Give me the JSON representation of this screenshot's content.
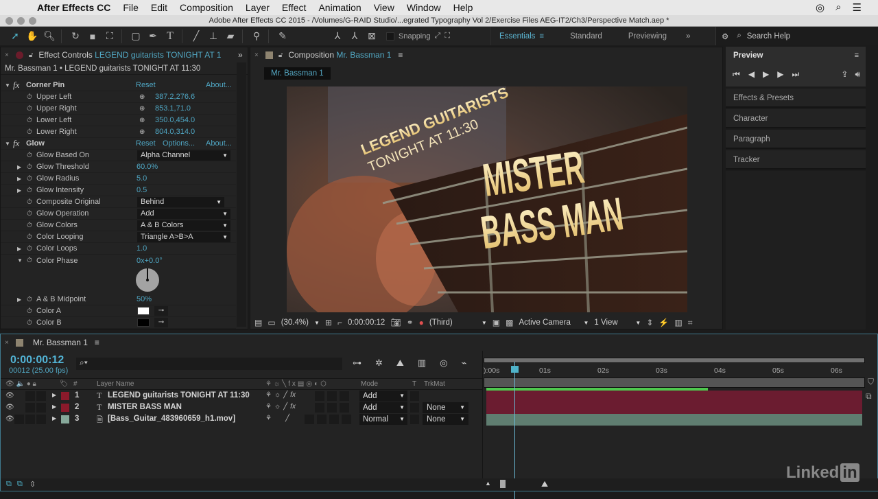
{
  "menubar": {
    "app": "After Effects CC",
    "items": [
      "File",
      "Edit",
      "Composition",
      "Layer",
      "Effect",
      "Animation",
      "View",
      "Window",
      "Help"
    ]
  },
  "titlebar": {
    "title": "Adobe After Effects CC 2015 - /Volumes/G-RAID Studio/...egrated Typography Vol 2/Exercise Files AEG-IT2/Ch3/Perspective Match.aep *"
  },
  "toolbar": {
    "snapping": "Snapping",
    "workspaces": [
      "Essentials",
      "Standard",
      "Previewing"
    ],
    "active_workspace": "Essentials",
    "search_help": "Search Help"
  },
  "effect_controls": {
    "tab_label": "Effect Controls",
    "tab_layer": "LEGEND guitarists TONIGHT AT 1",
    "subtitle": "Mr. Bassman 1 • LEGEND guitarists TONIGHT AT 11:30",
    "corner_pin": {
      "name": "Corner Pin",
      "reset": "Reset",
      "about": "About...",
      "props": [
        {
          "name": "Upper Left",
          "value": "387.2,276.6"
        },
        {
          "name": "Upper Right",
          "value": "853.1,71.0"
        },
        {
          "name": "Lower Left",
          "value": "350.0,454.0"
        },
        {
          "name": "Lower Right",
          "value": "804.0,314.0"
        }
      ]
    },
    "glow": {
      "name": "Glow",
      "reset": "Reset",
      "options": "Options...",
      "about": "About...",
      "glow_based_on": {
        "name": "Glow Based On",
        "value": "Alpha Channel"
      },
      "glow_threshold": {
        "name": "Glow Threshold",
        "value": "60.0%"
      },
      "glow_radius": {
        "name": "Glow Radius",
        "value": "5.0"
      },
      "glow_intensity": {
        "name": "Glow Intensity",
        "value": "0.5"
      },
      "composite_original": {
        "name": "Composite Original",
        "value": "Behind"
      },
      "glow_operation": {
        "name": "Glow Operation",
        "value": "Add"
      },
      "glow_colors": {
        "name": "Glow Colors",
        "value": "A & B Colors"
      },
      "color_looping": {
        "name": "Color Looping",
        "value": "Triangle A>B>A"
      },
      "color_loops": {
        "name": "Color Loops",
        "value": "1.0"
      },
      "color_phase": {
        "name": "Color Phase",
        "value": "0x+0.0°"
      },
      "ab_midpoint": {
        "name": "A & B Midpoint",
        "value": "50%"
      },
      "color_a": {
        "name": "Color A",
        "color": "#ffffff"
      },
      "color_b": {
        "name": "Color B",
        "color": "#000000"
      }
    }
  },
  "composition": {
    "tab_label": "Composition",
    "tab_comp": "Mr. Bassman 1",
    "flow_tab": "Mr. Bassman 1",
    "viewer_text": {
      "line1": "LEGEND GUITARISTS",
      "line2": "TONIGHT AT 11:30",
      "line3": "MISTER",
      "line4": "BASS MAN"
    },
    "footer": {
      "zoom": "(30.4%)",
      "timecode": "0:00:00:12",
      "resolution": "(Third)",
      "camera": "Active Camera",
      "views": "1 View"
    }
  },
  "right_panels": {
    "preview": "Preview",
    "panels": [
      "Effects & Presets",
      "Character",
      "Paragraph",
      "Tracker"
    ]
  },
  "timeline": {
    "tab": "Mr. Bassman 1",
    "timecode": "0:00:00:12",
    "frame_fps": "00012 (25.00 fps)",
    "search_placeholder": "",
    "columns": {
      "num": "#",
      "layer_name": "Layer Name",
      "mode": "Mode",
      "t": "T",
      "trkmat": "TrkMat"
    },
    "ticks": [
      "):00s",
      "01s",
      "02s",
      "03s",
      "04s",
      "05s",
      "06s"
    ],
    "layers": [
      {
        "num": "1",
        "type": "T",
        "name": "LEGEND guitarists TONIGHT AT 11:30",
        "mode": "Add",
        "trkmat": "",
        "label_color": "#8b1a2b",
        "bar_color": "#6b1c30"
      },
      {
        "num": "2",
        "type": "T",
        "name": "MISTER BASS MAN",
        "mode": "Add",
        "trkmat": "None",
        "label_color": "#8b1a2b",
        "bar_color": "#6b1c30"
      },
      {
        "num": "3",
        "type": "footage",
        "name": "[Bass_Guitar_483960659_h1.mov]",
        "mode": "Normal",
        "trkmat": "None",
        "label_color": "#86a89a",
        "bar_color": "#5f7d70"
      }
    ],
    "current_time_sec": 0.48,
    "duration_sec": 6.4,
    "cached_until_sec": 3.8
  },
  "watermark": {
    "linkedin": "Linked",
    "in": "in"
  }
}
